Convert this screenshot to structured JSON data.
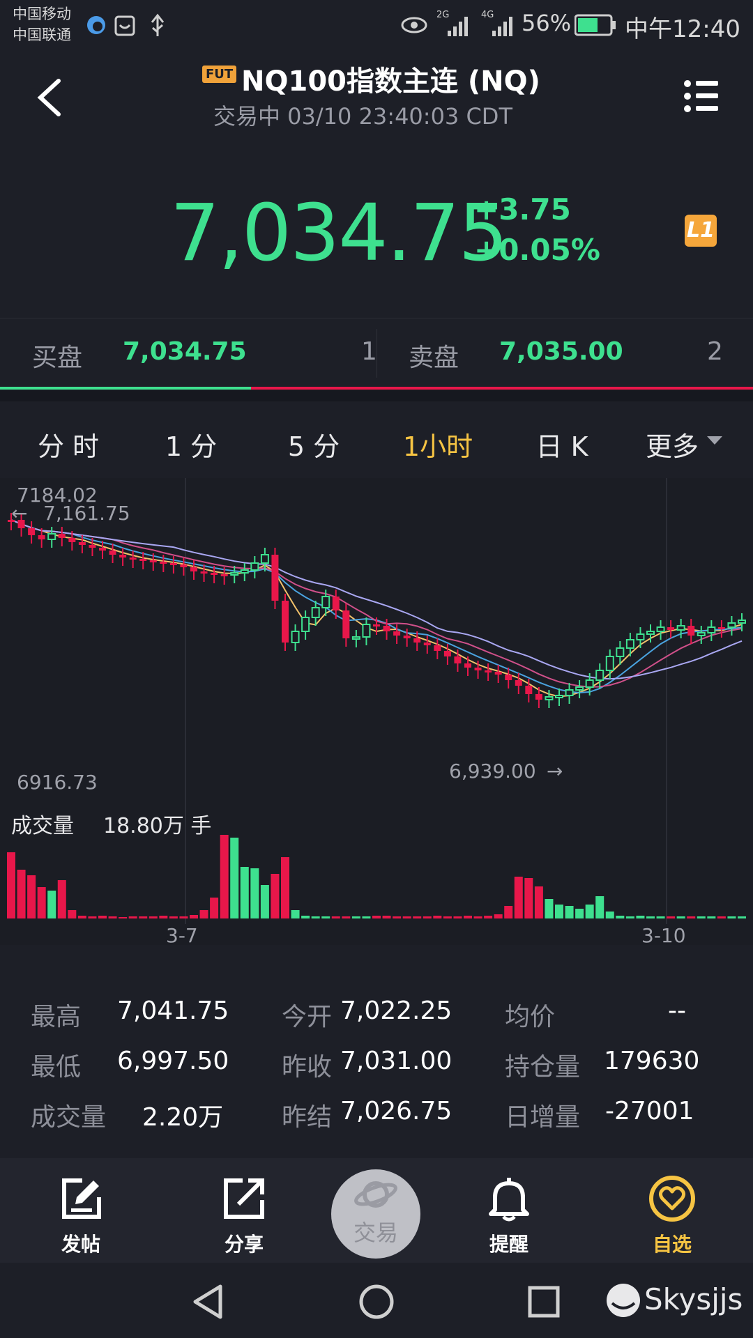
{
  "status_bar": {
    "carrier1": "中国移动",
    "carrier2": "中国联通",
    "network1": "2G",
    "network2": "4G",
    "battery": "56%",
    "time": "中午12:40"
  },
  "header": {
    "badge": "FUT",
    "title": "NQ100指数主连 (NQ)",
    "subtitle": "交易中 03/10 23:40:03 CDT"
  },
  "quote": {
    "price": "7,034.75",
    "change": "+3.75",
    "change_pct": "+0.05%",
    "level_badge": "L1"
  },
  "bid_ask": {
    "bid_label": "买盘",
    "bid_price": "7,034.75",
    "bid_qty": "1",
    "ask_label": "卖盘",
    "ask_price": "7,035.00",
    "ask_qty": "2",
    "bid_fraction": 0.333
  },
  "tabs": [
    {
      "label": "分 时"
    },
    {
      "label": "1 分"
    },
    {
      "label": "5 分"
    },
    {
      "label": "1小时"
    },
    {
      "label": "日 K"
    },
    {
      "label": "更多"
    }
  ],
  "active_tab": 3,
  "chart": {
    "top_label": "7184.02",
    "high_marker": "7,161.75",
    "bottom_label": "6916.73",
    "low_marker": "6,939.00",
    "volume_label": "成交量",
    "volume_value": "18.80万 手",
    "date_labels": [
      "3-7",
      "3-10"
    ]
  },
  "stats": [
    [
      {
        "label": "最高",
        "value": "7,041.75"
      },
      {
        "label": "今开",
        "value": "7,022.25"
      },
      {
        "label": "均价",
        "value": "--"
      }
    ],
    [
      {
        "label": "最低",
        "value": "6,997.50"
      },
      {
        "label": "昨收",
        "value": "7,031.00"
      },
      {
        "label": "持仓量",
        "value": "179630"
      }
    ],
    [
      {
        "label": "成交量",
        "value": "2.20万"
      },
      {
        "label": "昨结",
        "value": "7,026.75"
      },
      {
        "label": "日增量",
        "value": "-27001"
      }
    ]
  ],
  "toolbar": {
    "post": "发帖",
    "share": "分享",
    "trade": "交易",
    "alert": "提醒",
    "watchlist": "自选"
  },
  "watermark": "Skysjjs",
  "colors": {
    "up": "#3ee08f",
    "down": "#e8174a",
    "accent": "#f6c443",
    "background": "#1d1f27"
  }
}
